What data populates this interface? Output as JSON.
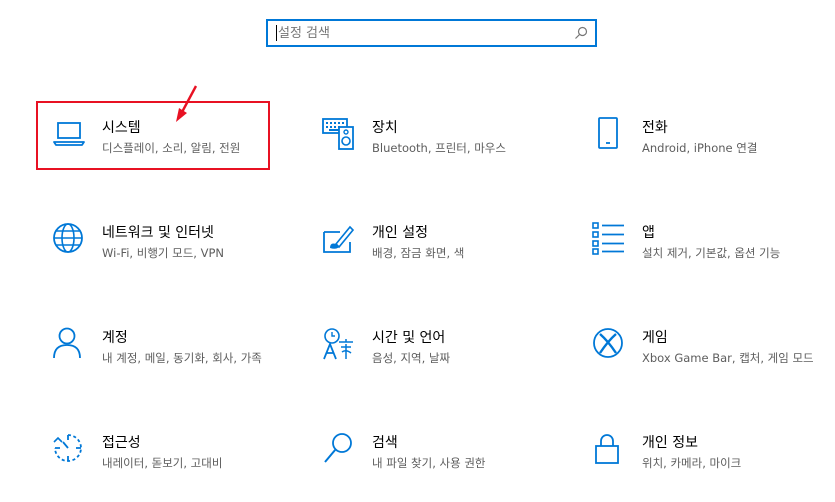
{
  "search": {
    "placeholder": "설정 검색",
    "value": ""
  },
  "colors": {
    "accent": "#0078d7",
    "highlight": "#e81123",
    "description": "#5d5d5d"
  },
  "tiles": [
    {
      "icon": "laptop-icon",
      "title": "시스템",
      "desc": "디스플레이, 소리, 알림, 전원"
    },
    {
      "icon": "keyboard-speaker-icon",
      "title": "장치",
      "desc": "Bluetooth, 프린터, 마우스"
    },
    {
      "icon": "phone-icon",
      "title": "전화",
      "desc": "Android, iPhone 연결"
    },
    {
      "icon": "globe-icon",
      "title": "네트워크 및 인터넷",
      "desc": "Wi-Fi, 비행기 모드, VPN"
    },
    {
      "icon": "paint-brush-icon",
      "title": "개인 설정",
      "desc": "배경, 잠금 화면, 색"
    },
    {
      "icon": "apps-list-icon",
      "title": "앱",
      "desc": "설치 제거, 기본값, 옵션 기능"
    },
    {
      "icon": "person-icon",
      "title": "계정",
      "desc": "내 계정, 메일, 동기화, 회사, 가족"
    },
    {
      "icon": "time-language-icon",
      "title": "시간 및 언어",
      "desc": "음성, 지역, 날짜"
    },
    {
      "icon": "xbox-icon",
      "title": "게임",
      "desc": "Xbox Game Bar, 캡처, 게임 모드"
    },
    {
      "icon": "ease-of-access-icon",
      "title": "접근성",
      "desc": "내레이터, 돋보기, 고대비"
    },
    {
      "icon": "search-magnifier-icon",
      "title": "검색",
      "desc": "내 파일 찾기, 사용 권한"
    },
    {
      "icon": "lock-icon",
      "title": "개인 정보",
      "desc": "위치, 카메라, 마이크"
    }
  ]
}
